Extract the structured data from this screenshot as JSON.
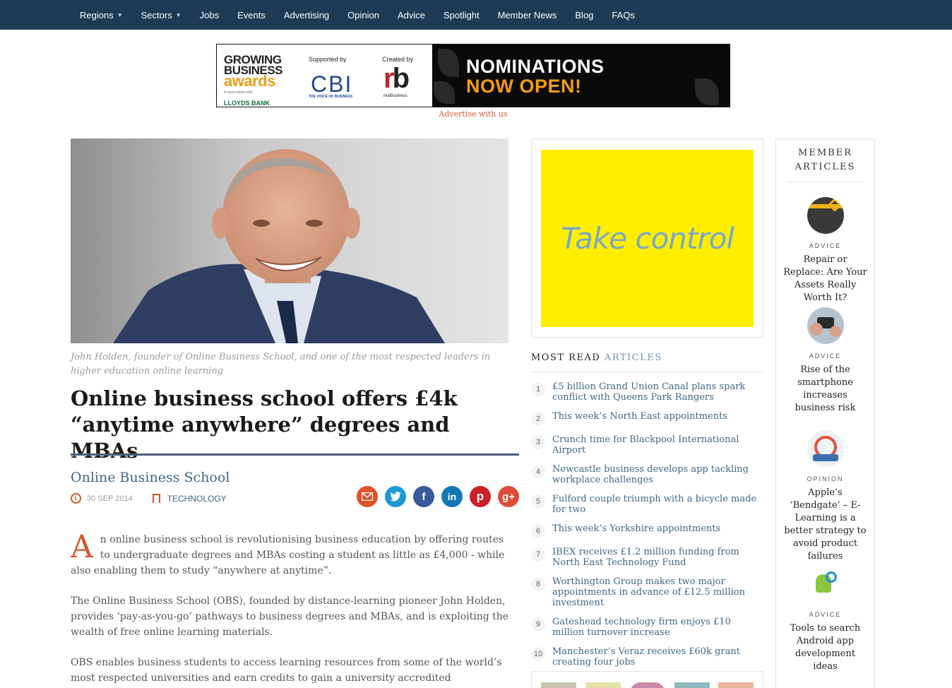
{
  "nav": {
    "items": [
      {
        "label": "Regions",
        "dropdown": true
      },
      {
        "label": "Sectors",
        "dropdown": true
      },
      {
        "label": "Jobs"
      },
      {
        "label": "Events"
      },
      {
        "label": "Advertising"
      },
      {
        "label": "Opinion"
      },
      {
        "label": "Advice"
      },
      {
        "label": "Spotlight"
      },
      {
        "label": "Member News"
      },
      {
        "label": "Blog"
      },
      {
        "label": "FAQs"
      }
    ]
  },
  "banner": {
    "gba_line1": "GROWING",
    "gba_line2": "BUSINESS",
    "gba_line3": "awards",
    "gba_assoc": "in association with",
    "gba_sponsor": "LLOYDS BANK",
    "supported_by": "Supported by",
    "cbi": "CBI",
    "cbi_tag": "THE VOICE OF BUSINESS",
    "created_by": "Created by",
    "rb_r": "r",
    "rb_b": "b",
    "rb_tag": "realbusiness",
    "headline1": "NOMINATIONS",
    "headline2": "NOW OPEN!",
    "advertise_link": "Advertise with us"
  },
  "article": {
    "caption": "John Holden, founder of Online Business School, and one of the most respected leaders in higher education online learning",
    "headline": "Online business school offers £4k “anytime anywhere” degrees and MBAs",
    "author": "Online Business School",
    "date": "30 SEP 2014",
    "category": "TECHNOLOGY",
    "dropcap": "A",
    "para1": "n online business school is revolutionising business education by offering routes to undergraduate degrees and MBAs costing a student as little as £4,000 - while also enabling them to study “anywhere at anytime”.",
    "para2": "The Online Business School (OBS), founded by distance-learning pioneer John Holden, provides ‘pay-as-you-go’ pathways to business degrees and MBAs, and is exploiting the wealth of free online learning materials.",
    "para3": "OBS enables business students to access learning resources from some of the world’s most respected universities and earn credits to gain a university accredited qualification."
  },
  "share": {
    "email": "email-icon",
    "twitter": "twitter-icon",
    "facebook": "facebook-icon",
    "linkedin": "linkedin-icon",
    "pinterest": "pinterest-icon",
    "googleplus": "googleplus-icon",
    "colors": {
      "email": "#e2502a",
      "twitter": "#1c9ad6",
      "facebook": "#3b5a9a",
      "linkedin": "#1377b5",
      "pinterest": "#cb2027",
      "googleplus": "#dd4b39"
    },
    "facebook_glyph": "f",
    "linkedin_glyph": "in",
    "pinterest_glyph": "p",
    "googleplus_glyph": "g+"
  },
  "ad": {
    "text": "Take control",
    "bg": "#ffee00"
  },
  "most_read": {
    "title_a": "MOST READ ",
    "title_b": "ARTICLES",
    "items": [
      {
        "num": "1",
        "text": "£5 billion Grand Union Canal plans spark conflict with Queens Park Rangers"
      },
      {
        "num": "2",
        "text": "This week’s North East appointments"
      },
      {
        "num": "3",
        "text": "Crunch time for Blackpool International Airport"
      },
      {
        "num": "4",
        "text": "Newcastle business develops app tackling workplace challenges"
      },
      {
        "num": "5",
        "text": "Fulford couple triumph with a bicycle made for two"
      },
      {
        "num": "6",
        "text": "This week’s Yorkshire appointments"
      },
      {
        "num": "7",
        "text": "IBEX receives £1.2 million funding from North East Technology Fund"
      },
      {
        "num": "8",
        "text": "Worthington Group makes two major appointments in advance of £12.5 million investment"
      },
      {
        "num": "9",
        "text": "Gateshead technology firm enjoys £10 million turnover increase"
      },
      {
        "num": "10",
        "text": "Manchester’s Veraz receives £60k grant creating four jobs"
      }
    ]
  },
  "member": {
    "title": "MEMBER ARTICLES",
    "items": [
      {
        "category": "ADVICE",
        "title": "Repair or Replace: Are Your Assets Really Worth It?"
      },
      {
        "category": "ADVICE",
        "title": "Rise of the smartphone increases business risk"
      },
      {
        "category": "OPINION",
        "title": "Apple’s ‘Bendgate’ – E-Learning is a better strategy to avoid product failures"
      },
      {
        "category": "ADVICE",
        "title": "Tools to search Android app development ideas"
      }
    ]
  }
}
